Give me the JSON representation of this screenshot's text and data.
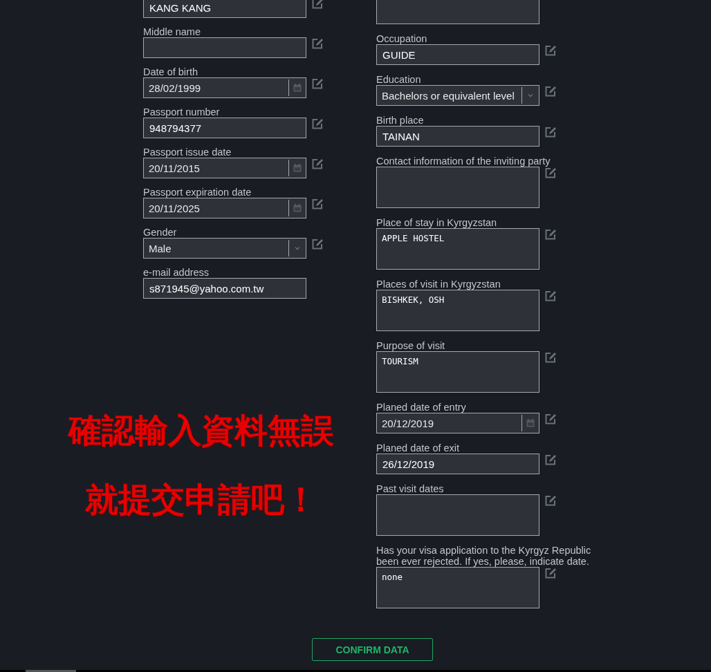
{
  "left_fields": [
    {
      "kind": "text",
      "value": "KANG KANG"
    },
    {
      "kind": "text",
      "label": "Middle name"
    },
    {
      "kind": "date",
      "label": "Date of birth",
      "value": "28/02/1999"
    },
    {
      "kind": "text",
      "label": "Passport number",
      "value": "948794377"
    },
    {
      "kind": "date",
      "label": "Passport issue date",
      "value": "20/11/2015"
    },
    {
      "kind": "date",
      "label": "Passport expiration date",
      "value": "20/11/2025"
    },
    {
      "kind": "select",
      "label": "Gender",
      "value": "Male"
    },
    {
      "kind": "text",
      "label": "e-mail address",
      "value": "s871945@yahoo.com.tw",
      "editable": false
    }
  ],
  "right_fields": [
    {
      "kind": "textarea",
      "editable": false
    },
    {
      "kind": "text",
      "label": "Occupation",
      "value": "GUIDE"
    },
    {
      "kind": "select",
      "label": "Education",
      "value": "Bachelors or equivalent level"
    },
    {
      "kind": "text",
      "label": "Birth place",
      "value": "TAINAN"
    },
    {
      "kind": "textarea",
      "label": "Contact information of the inviting party"
    },
    {
      "kind": "textarea",
      "label": "Place of stay in Kyrgyzstan",
      "value": "APPLE HOSTEL"
    },
    {
      "kind": "textarea",
      "label": "Places of visit in Kyrgyzstan",
      "value": "BISHKEK, OSH"
    },
    {
      "kind": "textarea",
      "label": "Purpose of visit",
      "value": "TOURISM"
    },
    {
      "kind": "date",
      "label": "Planed date of entry",
      "value": "20/12/2019"
    },
    {
      "kind": "text",
      "label": "Planed date of exit",
      "value": "26/12/2019"
    },
    {
      "kind": "textarea",
      "label": "Past visit dates"
    },
    {
      "kind": "textarea",
      "label": "Has your visa application to the Kyrgyz Republic been ever rejected. If yes, please, indicate date.",
      "value": "none"
    }
  ],
  "confirm_button": "CONFIRM DATA",
  "overlay_note": [
    "確認輸入資料無誤",
    "就提交申請吧！"
  ]
}
